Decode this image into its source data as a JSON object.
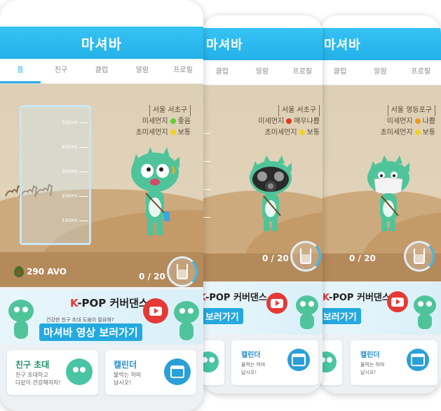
{
  "app": {
    "title": "마셔바"
  },
  "tabs": [
    "홈",
    "친구",
    "클럽",
    "알람",
    "프로필"
  ],
  "phones": {
    "main": {
      "location": "서울 서초구",
      "fine_dust_label": "미세먼지",
      "fine_dust_status": "좋음",
      "ultrafine_dust_label": "초미세먼지",
      "ultrafine_dust_status": "보통",
      "fine_dust_color": "#5fcf2f",
      "ultrafine_dust_color": "#f2d21a",
      "avo_count": "290 AVO",
      "water_count": "0 / 20",
      "cup_ticks": [
        "500ml",
        "400ml",
        "300ml",
        "200ml",
        "100ml"
      ]
    },
    "mid": {
      "location": "서울 서초구",
      "fine_dust_label": "미세먼지",
      "fine_dust_status": "매우나쁨",
      "ultrafine_dust_label": "초미세먼지",
      "ultrafine_dust_status": "보통",
      "fine_dust_color": "#e53a1e",
      "ultrafine_dust_color": "#f2d21a",
      "water_count": "0 / 20"
    },
    "back": {
      "location": "서울 영등포구",
      "fine_dust_label": "미세먼지",
      "fine_dust_status": "나쁨",
      "ultrafine_dust_label": "초미세먼지",
      "ultrafine_dust_status": "보통",
      "fine_dust_color": "#f29a1a",
      "ultrafine_dust_color": "#f2d21a",
      "water_count": "0 / 20"
    }
  },
  "banner": {
    "kpop": "K-POP 커버댄스",
    "kpop_k": "K",
    "watch": "마셔바 영상 보러가기",
    "tagline": "건강한 친구 초대 도움이 필요해?"
  },
  "cards": {
    "invite_title": "친구 초대",
    "invite_desc_1": "친구 초대하고",
    "invite_desc_2": "다같이 건강해지자!",
    "calendar_title": "캘린더",
    "calendar_desc_1": "물먹는 하마",
    "calendar_desc_2": "납시오!"
  },
  "icons": [
    "avocado-icon",
    "glass-icon",
    "youtube-icon",
    "friends-icon",
    "calendar-icon"
  ]
}
